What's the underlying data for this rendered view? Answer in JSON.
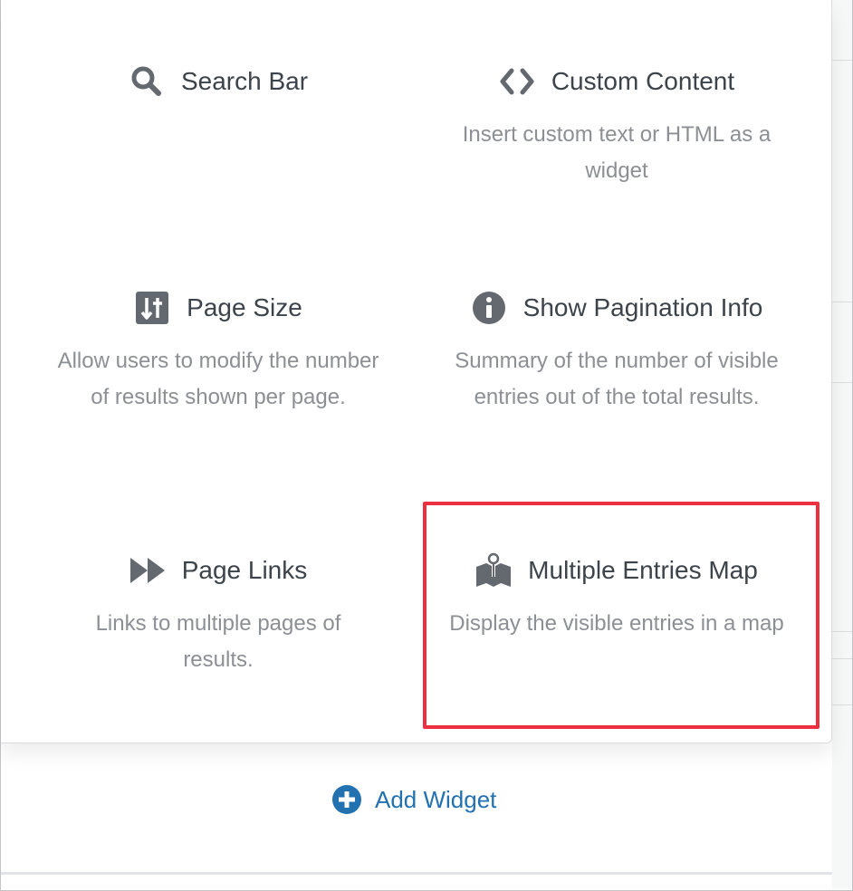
{
  "widgets": [
    {
      "title": "Search Bar",
      "description": "",
      "icon": "search-icon"
    },
    {
      "title": "Custom Content",
      "description": "Insert custom text or HTML as a widget",
      "icon": "code-icon"
    },
    {
      "title": "Page Size",
      "description": "Allow users to modify the number of results shown per page.",
      "icon": "sliders-icon"
    },
    {
      "title": "Show Pagination Info",
      "description": "Summary of the number of visible entries out of the total results.",
      "icon": "info-icon"
    },
    {
      "title": "Page Links",
      "description": "Links to multiple pages of results.",
      "icon": "fast-forward-icon"
    },
    {
      "title": "Multiple Entries Map",
      "description": "Display the visible entries in a map",
      "icon": "map-pin-icon",
      "highlighted": true
    }
  ],
  "add_widget": {
    "label": "Add Widget",
    "icon": "plus-circle-icon"
  },
  "colors": {
    "title_text": "#3c434a",
    "description_text": "#8c8f94",
    "icon": "#646970",
    "link": "#2271b1",
    "highlight_border": "#ee2f42"
  }
}
